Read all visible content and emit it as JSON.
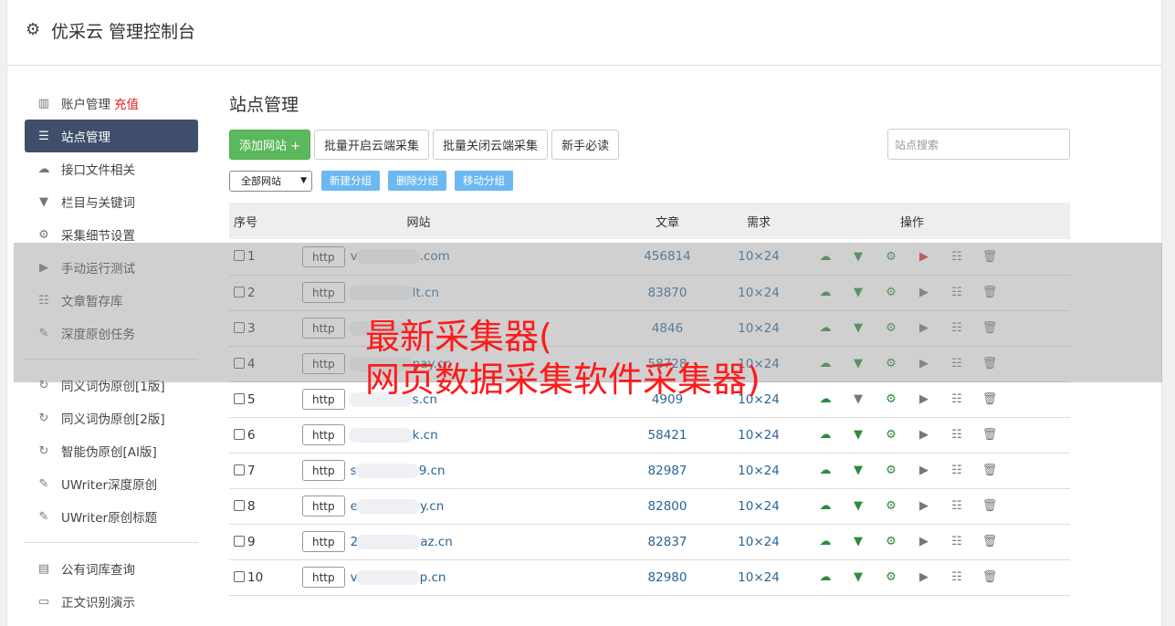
{
  "header": {
    "title": "优采云 管理控制台",
    "icon": "gear-icon"
  },
  "sidebar": {
    "group1": [
      {
        "label": "账户管理",
        "badge": "充值",
        "icon": "bar-chart-icon"
      },
      {
        "label": "站点管理",
        "icon": "server-icon",
        "active": true
      },
      {
        "label": "接口文件相关",
        "icon": "cloud-upload-icon"
      },
      {
        "label": "栏目与关键词",
        "icon": "filter-icon"
      },
      {
        "label": "采集细节设置",
        "icon": "gears-icon"
      },
      {
        "label": "手动运行测试",
        "icon": "play-icon"
      },
      {
        "label": "文章暂存库",
        "icon": "database-icon"
      },
      {
        "label": "深度原创任务",
        "icon": "edit-icon"
      }
    ],
    "group2": [
      {
        "label": "同义词伪原创[1版]",
        "icon": "refresh-icon"
      },
      {
        "label": "同义词伪原创[2版]",
        "icon": "refresh-icon"
      },
      {
        "label": "智能伪原创[AI版]",
        "icon": "refresh-icon"
      },
      {
        "label": "UWriter深度原创",
        "icon": "edit-icon"
      },
      {
        "label": "UWriter原创标题",
        "icon": "edit-icon"
      }
    ],
    "group3": [
      {
        "label": "公有词库查询",
        "icon": "book-icon"
      },
      {
        "label": "正文识别演示",
        "icon": "monitor-icon"
      }
    ]
  },
  "main": {
    "title": "站点管理",
    "add_site": "添加网站 +",
    "batch_open": "批量开启云端采集",
    "batch_close": "批量关闭云端采集",
    "newbie": "新手必读",
    "search_placeholder": "站点搜索",
    "group_select": "全部网站",
    "new_group": "新建分组",
    "delete_group": "删除分组",
    "move_group": "移动分组",
    "columns": {
      "no": "序号",
      "site": "网站",
      "articles": "文章",
      "demand": "需求",
      "ops": "操作"
    },
    "http_label": "http",
    "rows": [
      {
        "no": "1",
        "domain": "v",
        "domain2": ".com",
        "articles": "456814",
        "demand": "10×24",
        "play_active": true
      },
      {
        "no": "2",
        "domain": "",
        "domain2": "lt.cn",
        "articles": "83870",
        "demand": "10×24",
        "play_active": false
      },
      {
        "no": "3",
        "domain": "",
        "domain2": "",
        "articles": "4846",
        "demand": "10×24",
        "play_active": false
      },
      {
        "no": "4",
        "domain": "",
        "domain2": "pay.cn",
        "articles": "58728",
        "demand": "10×24",
        "play_active": false
      },
      {
        "no": "5",
        "domain": "",
        "domain2": "s.cn",
        "articles": "4909",
        "demand": "10×24",
        "play_active": false
      },
      {
        "no": "6",
        "domain": "",
        "domain2": "k.cn",
        "articles": "58421",
        "demand": "10×24",
        "play_active": false
      },
      {
        "no": "7",
        "domain": "s",
        "domain2": "9.cn",
        "articles": "82987",
        "demand": "10×24",
        "play_active": false
      },
      {
        "no": "8",
        "domain": "e",
        "domain2": "y.cn",
        "articles": "82800",
        "demand": "10×24",
        "play_active": false
      },
      {
        "no": "9",
        "domain": "2",
        "domain2": "az.cn",
        "articles": "82837",
        "demand": "10×24",
        "play_active": false
      },
      {
        "no": "10",
        "domain": "v",
        "domain2": "p.cn",
        "articles": "82980",
        "demand": "10×24",
        "play_active": false
      }
    ]
  },
  "overlay": {
    "line1": "最新采集器(",
    "line2": "网页数据采集软件采集器)"
  },
  "colors": {
    "accent": "#3f4f6b",
    "green": "#5cb85c",
    "link": "#2a6496",
    "overlay_text": "#ff1a1a"
  }
}
